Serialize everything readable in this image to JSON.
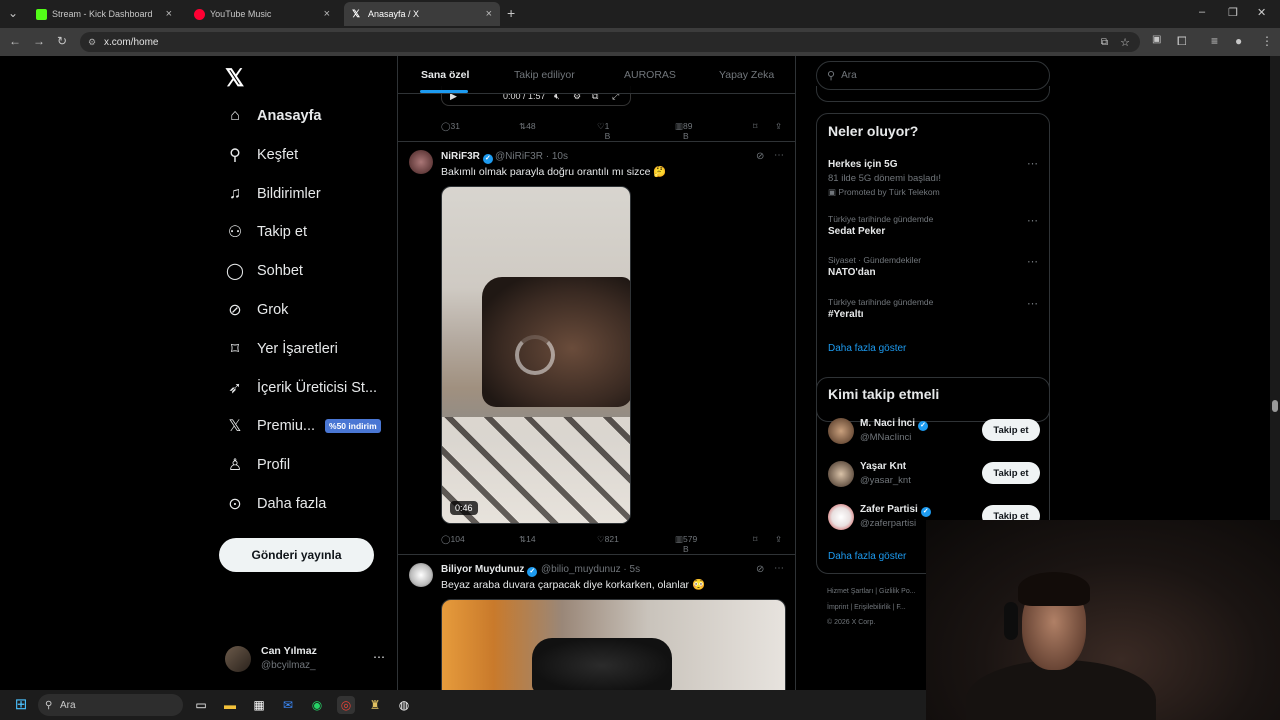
{
  "browser": {
    "tabs": [
      {
        "label": "Stream - Kick Dashboard",
        "color": "#53fc18"
      },
      {
        "label": "YouTube Music",
        "color": "#ff0033"
      },
      {
        "label": "Anasayfa / X",
        "color": "#ffffff"
      }
    ],
    "url": "x.com/home"
  },
  "nav": {
    "items": [
      {
        "label": "Anasayfa",
        "icon": "home-icon"
      },
      {
        "label": "Keşfet",
        "icon": "search-icon"
      },
      {
        "label": "Bildirimler",
        "icon": "bell-icon"
      },
      {
        "label": "Takip et",
        "icon": "add-user-icon"
      },
      {
        "label": "Sohbet",
        "icon": "chat-icon"
      },
      {
        "label": "Grok",
        "icon": "grok-icon"
      },
      {
        "label": "Yer İşaretleri",
        "icon": "bookmark-icon"
      },
      {
        "label": "İçerik Üreticisi St...",
        "icon": "rocket-icon"
      },
      {
        "label": "Premiu...",
        "icon": "x-icon"
      },
      {
        "label": "Profil",
        "icon": "person-icon"
      },
      {
        "label": "Daha fazla",
        "icon": "more-circle-icon"
      }
    ],
    "premium_badge": "%50 indirim",
    "post_button": "Gönderi yayınla",
    "profile": {
      "name": "Can Yılmaz",
      "handle": "@bcyilmaz_"
    }
  },
  "feed": {
    "tabs": [
      "Sana özel",
      "Takip ediliyor",
      "AURORAS",
      "Yapay Zeka"
    ],
    "player_time": "0:00 / 1:57",
    "prev_stats": {
      "replies": "31",
      "reposts": "48",
      "likes": "1 B",
      "views": "89 B"
    },
    "tweets": [
      {
        "name": "NiRiF3R",
        "handle": "@NiRiF3R",
        "time": "10s",
        "text": "Bakımlı olmak parayla doğru orantılı mı sizce 🤔",
        "duration": "0:46",
        "replies": "104",
        "reposts": "14",
        "likes": "821",
        "views": "579 B"
      },
      {
        "name": "Biliyor Muydunuz",
        "handle": "@bilio_muydunuz",
        "time": "5s",
        "text": "Beyaz araba duvara çarpacak diye korkarken, olanlar 😳"
      }
    ]
  },
  "sidebar": {
    "search_placeholder": "Ara",
    "trends_title": "Neler oluyor?",
    "trends": [
      {
        "meta": "",
        "title": "Herkes için 5G",
        "sub": "81 ilde 5G dönemi başladı!",
        "promo": "Promoted by Türk Telekom"
      },
      {
        "meta": "Türkiye tarihinde gündemde",
        "title": "Sedat Peker"
      },
      {
        "meta": "Siyaset · Gündemdekiler",
        "title": "NATO'dan"
      },
      {
        "meta": "Türkiye tarihinde gündemde",
        "title": "#Yeraltı"
      }
    ],
    "show_more": "Daha fazla göster",
    "who_title": "Kimi takip etmeli",
    "who": [
      {
        "name": "M. Naci İnci",
        "handle": "@MNacIinci",
        "verified": true
      },
      {
        "name": "Yaşar Knt",
        "handle": "@yasar_knt",
        "verified": false
      },
      {
        "name": "Zafer Partisi",
        "handle": "@zaferpartisi",
        "verified": true
      }
    ],
    "follow_label": "Takip et",
    "footer1": "Hizmet Şartları  |  Gizlilik Po...",
    "footer2": "İmprint  |  Erişilebilirlik  |  F...",
    "footer3": "© 2026 X Corp."
  },
  "taskbar": {
    "search": "Ara"
  }
}
